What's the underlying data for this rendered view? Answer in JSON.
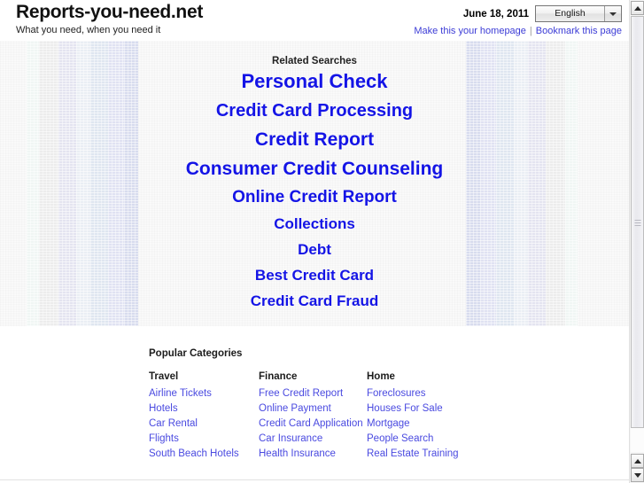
{
  "header": {
    "site_title": "Reports-you-need.net",
    "tagline": "What you need, when you need it",
    "date": "June 18, 2011",
    "language": {
      "selected": "English",
      "arrow_icon": "chevron-down-icon"
    },
    "links": {
      "homepage": "Make this your homepage",
      "separator": "|",
      "bookmark": "Bookmark this page"
    }
  },
  "banner": {
    "heading": "Related Searches",
    "searches": [
      {
        "label": "Personal Check",
        "size": 22
      },
      {
        "label": "Credit Card Processing",
        "size": 20
      },
      {
        "label": "Credit Report",
        "size": 21
      },
      {
        "label": "Consumer Credit Counseling",
        "size": 21
      },
      {
        "label": "Online Credit Report",
        "size": 19
      },
      {
        "label": "Collections",
        "size": 17
      },
      {
        "label": "Debt",
        "size": 17
      },
      {
        "label": "Best Credit Card",
        "size": 17
      },
      {
        "label": "Credit Card Fraud",
        "size": 17
      }
    ]
  },
  "popular": {
    "title": "Popular Categories",
    "columns": [
      {
        "heading": "Travel",
        "items": [
          "Airline Tickets",
          "Hotels",
          "Car Rental",
          "Flights",
          "South Beach Hotels"
        ]
      },
      {
        "heading": "Finance",
        "items": [
          "Free Credit Report",
          "Online Payment",
          "Credit Card Application",
          "Car Insurance",
          "Health Insurance"
        ]
      },
      {
        "heading": "Home",
        "items": [
          "Foreclosures",
          "Houses For Sale",
          "Mortgage",
          "People Search",
          "Real Estate Training"
        ]
      }
    ]
  },
  "scrollbar": {
    "up_icon": "scroll-up-arrow-icon",
    "down_icon": "scroll-down-arrow-icon"
  },
  "colors": {
    "search_link": "#1414e6",
    "category_link": "#4a4ae0",
    "header_link": "#3b3bd6",
    "text": "#1c1c1c",
    "page_background": "#ffffff",
    "banner_background": "#fbfbfb"
  },
  "stripes": {
    "left": [
      "#f0f6f4",
      "#ececec",
      "#e4e4f0",
      "#eaeef4",
      "#dfe6f0",
      "#e0e2f2",
      "#d8dcee"
    ],
    "right": [
      "#f0f6f4",
      "#ececec",
      "#e4e4f0",
      "#eaeef4",
      "#dfe6f0",
      "#e0e2f2",
      "#d8dcee"
    ],
    "widths": [
      14,
      22,
      20,
      16,
      20,
      18,
      16
    ]
  }
}
